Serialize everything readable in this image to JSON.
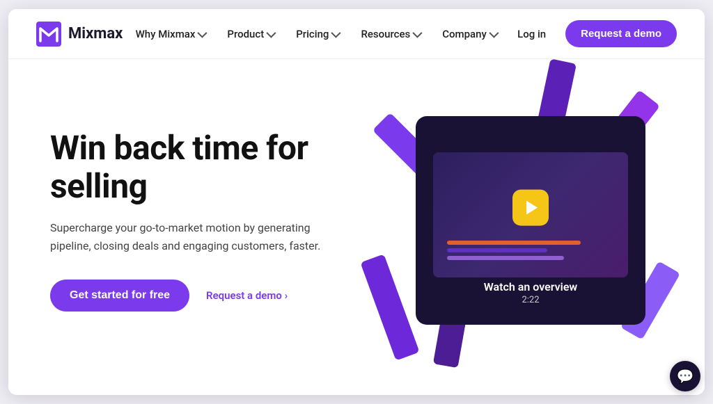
{
  "brand": {
    "logo_text": "Mixmax",
    "logo_alt": "Mixmax logo"
  },
  "navbar": {
    "links": [
      {
        "label": "Why Mixmax",
        "has_dropdown": true
      },
      {
        "label": "Product",
        "has_dropdown": true
      },
      {
        "label": "Pricing",
        "has_dropdown": true
      },
      {
        "label": "Resources",
        "has_dropdown": true
      },
      {
        "label": "Company",
        "has_dropdown": true
      }
    ],
    "login_label": "Log in",
    "demo_label": "Request a demo"
  },
  "hero": {
    "title": "Win back time for selling",
    "subtitle": "Supercharge your go-to-market motion by generating pipeline, closing deals and engaging customers, faster.",
    "cta_primary": "Get started for free",
    "cta_secondary": "Request a demo ›"
  },
  "video": {
    "caption": "Watch an overview",
    "duration": "2:22"
  },
  "chat": {
    "icon": "💬"
  }
}
